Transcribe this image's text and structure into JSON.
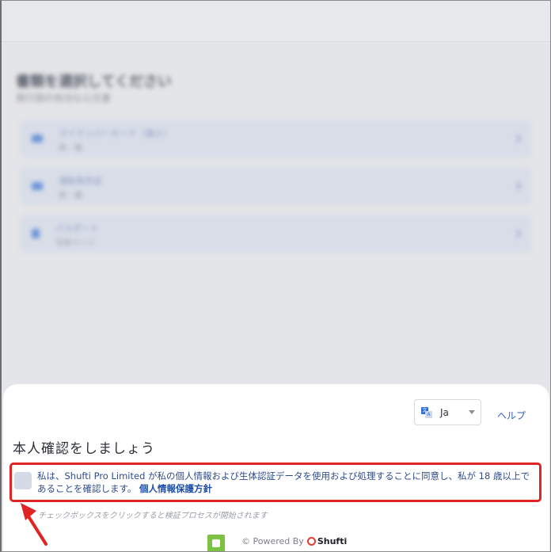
{
  "background": {
    "title": "書類を選択してください",
    "subtitle": "発行国の有効な公文書",
    "items": [
      {
        "title": "マイナンバーカード（個人）",
        "sub": "表・裏"
      },
      {
        "title": "運転免許証",
        "sub": "表・裏"
      },
      {
        "title": "パスポート",
        "sub": "写真ページ"
      }
    ]
  },
  "sheet": {
    "language_value": "Ja",
    "translate_icon_a": "文",
    "translate_icon_b": "A",
    "help_label": "ヘルプ",
    "title": "本人確認をしましょう",
    "consent_text": "私は、Shufti Pro Limited が私の個人情報および生体認証データを使用および処理することに同意し、私が 18 歳以上であることを確認します。",
    "consent_link": "個人情報保護方針",
    "hint": "チェックボックスをクリックすると検証プロセスが開始されます",
    "powered_by": "© Powered By",
    "brand_name": "Shufti"
  },
  "colors": {
    "accent_link": "#2f5fb3",
    "annotation_red": "#e02424",
    "brand_green": "#7dc242"
  }
}
